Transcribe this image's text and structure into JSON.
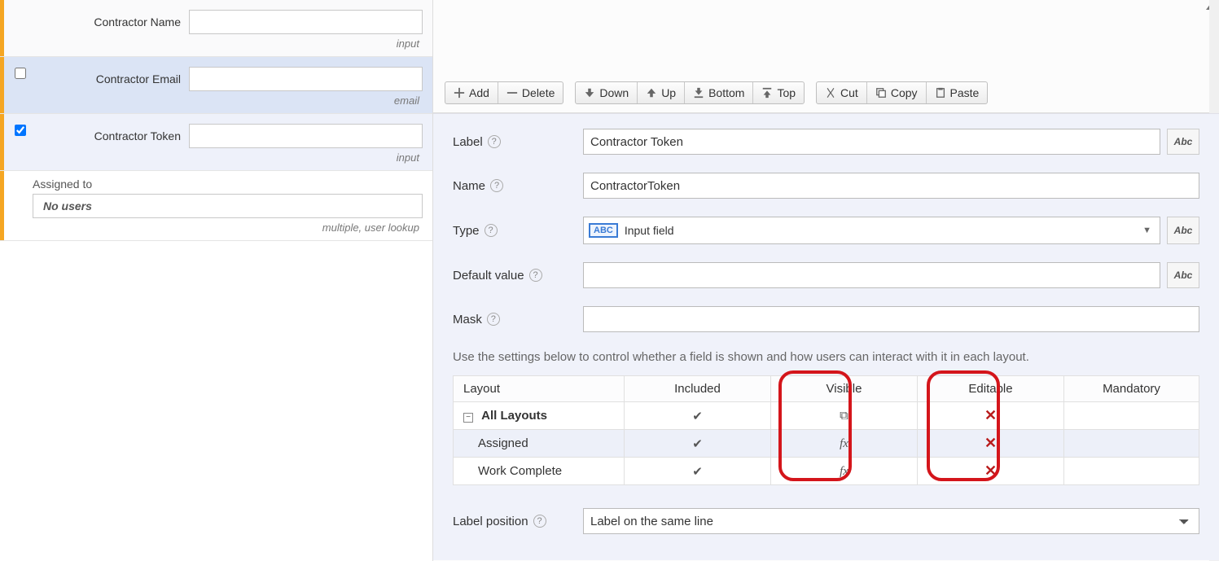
{
  "left": {
    "rows": [
      {
        "label": "Contractor Name",
        "tag": "input",
        "checked": false,
        "show_cb": false,
        "selected": "none"
      },
      {
        "label": "Contractor Email",
        "tag": "email",
        "checked": false,
        "show_cb": true,
        "selected": "blue"
      },
      {
        "label": "Contractor Token",
        "tag": "input",
        "checked": true,
        "show_cb": true,
        "selected": "light"
      }
    ],
    "assigned": {
      "title": "Assigned to",
      "value": "No users",
      "tag": "multiple, user lookup"
    }
  },
  "toolbar": {
    "add": "Add",
    "delete": "Delete",
    "down": "Down",
    "up": "Up",
    "bottom": "Bottom",
    "top": "Top",
    "cut": "Cut",
    "copy": "Copy",
    "paste": "Paste"
  },
  "props": {
    "label_label": "Label",
    "label_value": "Contractor Token",
    "name_label": "Name",
    "name_value": "ContractorToken",
    "type_label": "Type",
    "type_chip": "ABC",
    "type_value": "Input field",
    "default_label": "Default value",
    "default_value": "",
    "mask_label": "Mask",
    "mask_value": "",
    "abc": "Abc",
    "instruction": "Use the settings below to control whether a field is shown and how users can interact with it in each layout.",
    "labelpos_label": "Label position",
    "labelpos_value": "Label on the same line"
  },
  "layout_table": {
    "headers": {
      "layout": "Layout",
      "included": "Included",
      "visible": "Visible",
      "editable": "Editable",
      "mandatory": "Mandatory"
    },
    "rows": [
      {
        "name": "All Layouts",
        "bold": true,
        "expand": true,
        "included": "check",
        "visible": "copy",
        "editable": "x",
        "mandatory": ""
      },
      {
        "name": "Assigned",
        "included": "check",
        "visible": "fx",
        "editable": "x",
        "mandatory": ""
      },
      {
        "name": "Work Complete",
        "included": "check",
        "visible": "fx",
        "editable": "x",
        "mandatory": ""
      }
    ]
  }
}
